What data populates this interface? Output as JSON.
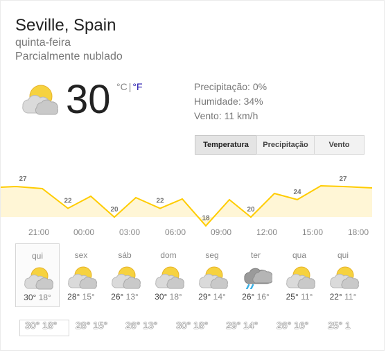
{
  "header": {
    "location": "Seville, Spain",
    "day": "quinta-feira",
    "condition": "Parcialmente nublado"
  },
  "current": {
    "temp": "30",
    "unit_c": "°C",
    "separator": "|",
    "unit_f": "°F",
    "icon": "partly-cloudy-icon"
  },
  "details": {
    "precipitation": "Precipitação: 0%",
    "humidity": "Humidade: 34%",
    "wind": "Vento: 11 km/h"
  },
  "tabs": {
    "temperature": "Temperatura",
    "precipitation": "Precipitação",
    "wind": "Vento"
  },
  "chart_data": {
    "type": "area",
    "x": [
      "21:00",
      "00:00",
      "03:00",
      "06:00",
      "09:00",
      "12:00",
      "15:00",
      "18:00"
    ],
    "values": [
      27,
      22,
      20,
      22,
      18,
      20,
      24,
      27
    ],
    "labels": [
      "27",
      "22",
      "20",
      "22",
      "18",
      "20",
      "24",
      "27"
    ],
    "line_color": "#ffcc00",
    "fill_color": "#fff6d6"
  },
  "hours": [
    "21:00",
    "00:00",
    "03:00",
    "06:00",
    "09:00",
    "12:00",
    "15:00",
    "18:00"
  ],
  "forecast": [
    {
      "day": "qui",
      "icon": "partly-cloudy-icon",
      "hi": "30°",
      "lo": "18°"
    },
    {
      "day": "sex",
      "icon": "partly-cloudy-icon",
      "hi": "28°",
      "lo": "15°"
    },
    {
      "day": "sáb",
      "icon": "partly-cloudy-icon",
      "hi": "26°",
      "lo": "13°"
    },
    {
      "day": "dom",
      "icon": "partly-cloudy-icon",
      "hi": "30°",
      "lo": "18°"
    },
    {
      "day": "seg",
      "icon": "partly-cloudy-icon",
      "hi": "29°",
      "lo": "14°"
    },
    {
      "day": "ter",
      "icon": "rain-icon",
      "hi": "26°",
      "lo": "16°"
    },
    {
      "day": "qua",
      "icon": "partly-cloudy-icon",
      "hi": "25°",
      "lo": "11°"
    },
    {
      "day": "qui",
      "icon": "partly-cloudy-icon",
      "hi": "22°",
      "lo": "11°"
    }
  ],
  "ghost_row": [
    "30° 18°",
    "28° 15°",
    "26° 13°",
    "30° 18°",
    "29° 14°",
    "26° 16°",
    "25° 1"
  ]
}
